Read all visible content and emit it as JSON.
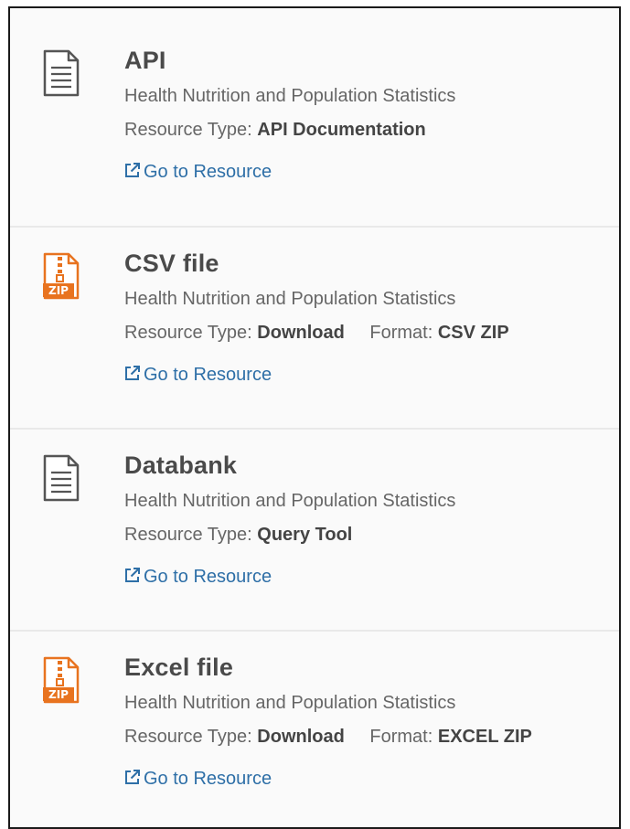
{
  "colors": {
    "link": "#2e6fa7",
    "zip_icon": "#e8731f",
    "doc_icon": "#555555",
    "title": "#4a4a4a",
    "text": "#666666"
  },
  "resources": [
    {
      "icon": "document-icon",
      "title": "API",
      "subtitle": "Health Nutrition and Population Statistics",
      "type_label": "Resource Type:",
      "type_value": "API Documentation",
      "format_label": "",
      "format_value": "",
      "link_label": "Go to Resource"
    },
    {
      "icon": "zip-file-icon",
      "title": "CSV file",
      "subtitle": "Health Nutrition and Population Statistics",
      "type_label": "Resource Type:",
      "type_value": "Download",
      "format_label": "Format:",
      "format_value": "CSV ZIP",
      "link_label": "Go to Resource"
    },
    {
      "icon": "document-icon",
      "title": "Databank",
      "subtitle": "Health Nutrition and Population Statistics",
      "type_label": "Resource Type:",
      "type_value": "Query Tool",
      "format_label": "",
      "format_value": "",
      "link_label": "Go to Resource"
    },
    {
      "icon": "zip-file-icon",
      "title": "Excel file",
      "subtitle": "Health Nutrition and Population Statistics",
      "type_label": "Resource Type:",
      "type_value": "Download",
      "format_label": "Format:",
      "format_value": "EXCEL ZIP",
      "link_label": "Go to Resource"
    }
  ]
}
